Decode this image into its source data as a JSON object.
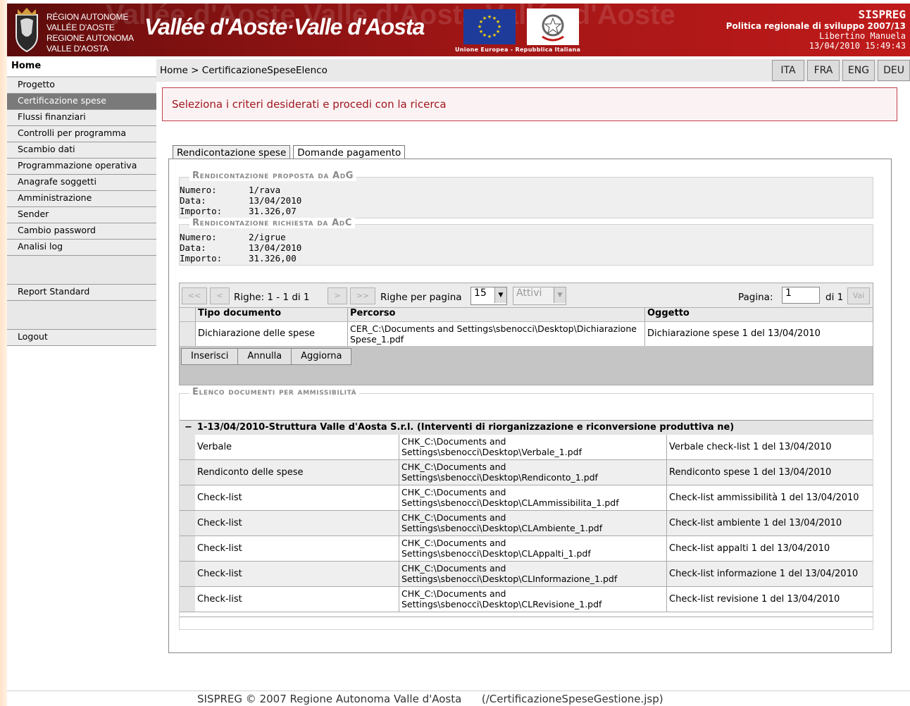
{
  "header": {
    "region_names": [
      "Région Autonome",
      "Vallée d'Aoste",
      "Regione Autonoma",
      "Valle d'Aosta"
    ],
    "brand": "Vallée d'Aoste·Valle d'Aosta",
    "flag_caption": "Unione Europea - Repubblica Italiana",
    "app_name": "SISPREG",
    "subtitle": "Politica regionale di sviluppo 2007/13",
    "user": "Libertino Manuela",
    "datetime": "13/04/2010 15:49:43"
  },
  "sidebar": {
    "home": "Home",
    "items": [
      "Progetto",
      "Certificazione spese",
      "Flussi finanziari",
      "Controlli per programma",
      "Scambio dati",
      "Programmazione operativa",
      "Anagrafe soggetti",
      "Amministrazione",
      "Sender",
      "Cambio password",
      "Analisi log"
    ],
    "active_index": 1,
    "report": "Report Standard",
    "logout": "Logout"
  },
  "breadcrumb": "Home > CertificazioneSpeseElenco",
  "languages": [
    "ITA",
    "FRA",
    "ENG",
    "DEU"
  ],
  "message": "Seleziona i criteri desiderati e procedi con la ricerca",
  "tabs": [
    "Rendicontazione spese",
    "Domande pagamento"
  ],
  "proposta": {
    "legend": "Rendicontazione proposta da AdG",
    "numero_label": "Numero:",
    "numero": "1/rava",
    "data_label": "Data:",
    "data": "13/04/2010",
    "importo_label": "Importo:",
    "importo": "31.326,07"
  },
  "richiesta": {
    "legend": "Rendicontazione richiesta da AdC",
    "numero_label": "Numero:",
    "numero": "2/igrue",
    "data_label": "Data:",
    "data": "13/04/2010",
    "importo_label": "Importo:",
    "importo": "31.326,00"
  },
  "pager": {
    "first": "<<",
    "prev": "<",
    "next": ">",
    "last": ">>",
    "rows_text": "Righe: 1 - 1 di 1",
    "per_page_label": "Righe per pagina",
    "per_page": "15",
    "filter": "Attivi",
    "page_label": "Pagina:",
    "page": "1",
    "of": "di 1",
    "go": "Vai"
  },
  "grid": {
    "headers": [
      "Tipo documento",
      "Percorso",
      "Oggetto"
    ],
    "row": {
      "tipo": "Dichiarazione delle spese",
      "percorso": "CER_C:\\Documents and Settings\\sbenocci\\Desktop\\Dichiarazione Spese_1.pdf",
      "oggetto": "Dichiarazione spese 1 del 13/04/2010"
    },
    "buttons": [
      "Inserisci",
      "Annulla",
      "Aggiorna"
    ]
  },
  "elenco": {
    "legend": "Elenco documenti per ammissibilità",
    "toggle": "−",
    "group": "1-13/04/2010-Struttura Valle d'Aosta S.r.l. (Interventi di riorganizzazione e riconversione produttiva ne)",
    "rows": [
      {
        "tipo": "Verbale",
        "percorso": "CHK_C:\\Documents and Settings\\sbenocci\\Desktop\\Verbale_1.pdf",
        "oggetto": "Verbale check-list 1 del 13/04/2010"
      },
      {
        "tipo": "Rendiconto delle spese",
        "percorso": "CHK_C:\\Documents and Settings\\sbenocci\\Desktop\\Rendiconto_1.pdf",
        "oggetto": "Rendiconto spese 1 del 13/04/2010"
      },
      {
        "tipo": "Check-list",
        "percorso": "CHK_C:\\Documents and Settings\\sbenocci\\Desktop\\CLAmmissibilita_1.pdf",
        "oggetto": "Check-list ammissibilità 1 del 13/04/2010"
      },
      {
        "tipo": "Check-list",
        "percorso": "CHK_C:\\Documents and Settings\\sbenocci\\Desktop\\CLAmbiente_1.pdf",
        "oggetto": "Check-list ambiente 1 del 13/04/2010"
      },
      {
        "tipo": "Check-list",
        "percorso": "CHK_C:\\Documents and Settings\\sbenocci\\Desktop\\CLAppalti_1.pdf",
        "oggetto": "Check-list appalti 1 del 13/04/2010"
      },
      {
        "tipo": "Check-list",
        "percorso": "CHK_C:\\Documents and Settings\\sbenocci\\Desktop\\CLInformazione_1.pdf",
        "oggetto": "Check-list informazione 1 del 13/04/2010"
      },
      {
        "tipo": "Check-list",
        "percorso": "CHK_C:\\Documents and Settings\\sbenocci\\Desktop\\CLRevisione_1.pdf",
        "oggetto": "Check-list revisione 1 del 13/04/2010"
      }
    ]
  },
  "footer": "SISPREG © 2007 Regione Autonoma Valle d'Aosta      (/CertificazioneSpeseGestione.jsp)",
  "colors": {
    "header_red": "#a31616",
    "message_red": "#a01620",
    "active_menu": "#7a7a7a"
  }
}
